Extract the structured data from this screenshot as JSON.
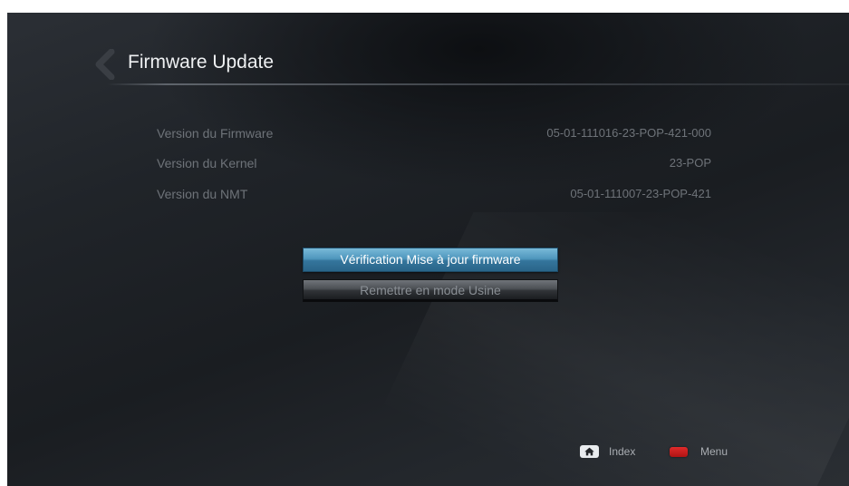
{
  "header": {
    "title": "Firmware Update",
    "back_icon": "back-chevron-icon"
  },
  "info": [
    {
      "label": "Version du Firmware",
      "value": "05-01-111016-23-POP-421-000"
    },
    {
      "label": "Version du Kernel",
      "value": "23-POP"
    },
    {
      "label": "Version du NMT",
      "value": "05-01-111007-23-POP-421"
    }
  ],
  "buttons": {
    "check_update": "Vérification Mise à jour firmware",
    "factory_reset": "Remettre en mode Usine"
  },
  "footer": {
    "index_label": "Index",
    "index_icon": "home-icon",
    "menu_label": "Menu",
    "menu_icon": "red-key-icon"
  },
  "colors": {
    "accent_button": "#4f97bd",
    "red_key": "#d11f1f"
  }
}
